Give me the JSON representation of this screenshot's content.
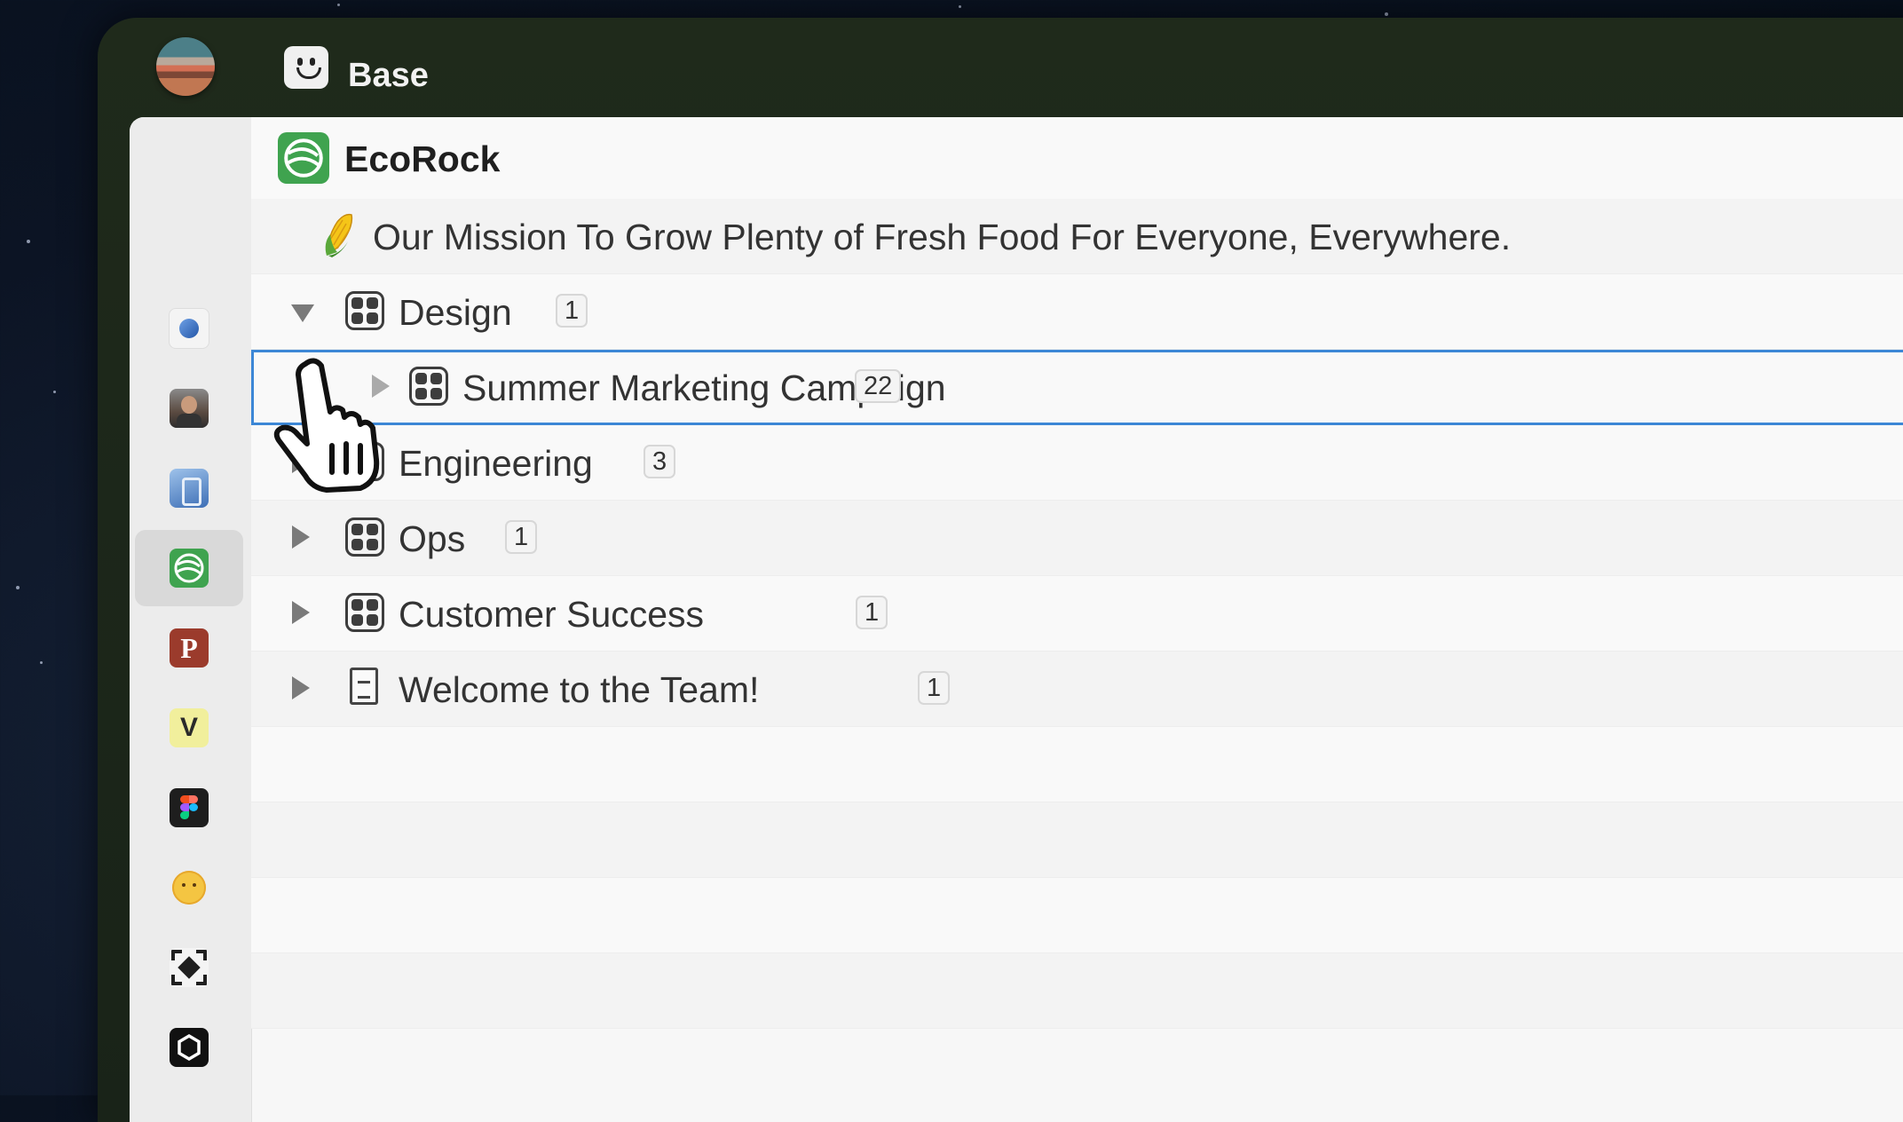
{
  "topbar": {
    "title": "Base"
  },
  "sidebar": {
    "apps": [
      {
        "name": "globe",
        "color": "#3a73c9"
      },
      {
        "name": "person-photo",
        "color": "#6b5a4e"
      },
      {
        "name": "illustration",
        "color": "#4b80c8"
      },
      {
        "name": "ecorock",
        "color": "#3fa34f",
        "active": true
      },
      {
        "name": "p-app",
        "letter": "P",
        "color": "#9b3b2c"
      },
      {
        "name": "v-app",
        "letter": "V",
        "color": "#f1ef9c"
      },
      {
        "name": "figma",
        "color": "#1e1e1e"
      },
      {
        "name": "smiley",
        "color": "#f4c542"
      },
      {
        "name": "focus-app",
        "color": "#1f1f1f"
      },
      {
        "name": "hexagon-app",
        "color": "#111111"
      }
    ]
  },
  "workspace": {
    "title": "EcoRock"
  },
  "mission": {
    "emoji": "🌽",
    "text": "Our Mission To Grow Plenty of Fresh Food For Everyone, Everywhere."
  },
  "tree": [
    {
      "label": "Design",
      "count": "1",
      "expanded": true,
      "icon": "grid-icon"
    },
    {
      "label": "Summer Marketing Campaign",
      "count": "22",
      "selected": true,
      "icon": "grid-icon"
    },
    {
      "label": "Engineering",
      "count": "3",
      "icon": "grid-icon"
    },
    {
      "label": "Ops",
      "count": "1",
      "icon": "grid-icon"
    },
    {
      "label": "Customer Success",
      "count": "1",
      "icon": "grid-icon"
    },
    {
      "label": "Welcome to the Team!",
      "count": "1",
      "icon": "document-icon"
    }
  ],
  "colors": {
    "accent": "#3c87d6",
    "brand": "#3fa34f"
  }
}
